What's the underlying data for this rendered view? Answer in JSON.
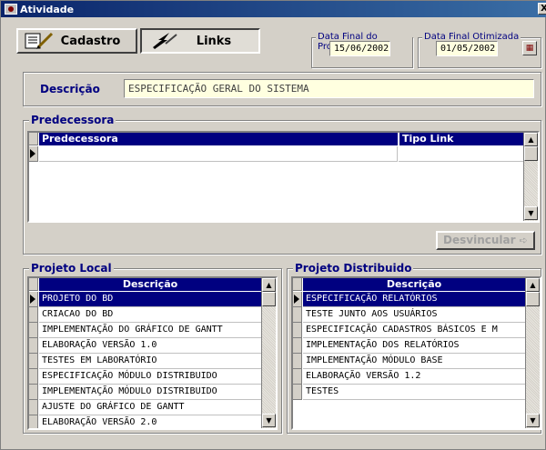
{
  "window": {
    "title": "Atividade",
    "close_glyph": "X"
  },
  "tabs": [
    {
      "label": "Cadastro",
      "icon": "notepad-pencil-icon"
    },
    {
      "label": "Links",
      "icon": "link-pen-icon"
    }
  ],
  "dates": {
    "projeto_label": "Data Final do Projeto",
    "projeto_value": "15/06/2002",
    "otimizada_label": "Data Final Otimizada",
    "otimizada_value": "01/05/2002",
    "calendar_glyph": "▦"
  },
  "descricao": {
    "label": "Descrição",
    "value": "ESPECIFICAÇÃO GERAL DO SISTEMA"
  },
  "predecessora": {
    "title": "Predecessora",
    "columns": [
      "Predecessora",
      "Tipo Link"
    ],
    "button": "Desvincular"
  },
  "projeto_local": {
    "title": "Projeto Local",
    "column": "Descrição",
    "rows": [
      "PROJETO DO BD",
      "CRIACAO DO BD",
      "IMPLEMENTAÇÃO DO GRÁFICO DE GANTT",
      "ELABORAÇÃO VERSÃO 1.0",
      "TESTES EM LABORATÓRIO",
      "ESPECIFICAÇÃO MÓDULO DISTRIBUIDO",
      "IMPLEMENTAÇÃO MÓDULO DISTRIBUIDO",
      "AJUSTE DO GRÁFICO DE GANTT",
      "ELABORAÇÃO VERSÃO 2.0"
    ]
  },
  "projeto_distribuido": {
    "title": "Projeto Distribuido",
    "column": "Descrição",
    "rows": [
      "ESPECIFICAÇÃO RELATÓRIOS",
      "TESTE JUNTO AOS USUÁRIOS",
      "ESPECIFICAÇÃO CADASTROS BÁSICOS E M",
      "IMPLEMENTAÇÃO DOS RELATÓRIOS",
      "IMPLEMENTAÇÃO MÓDULO BASE",
      "ELABORAÇÃO VERSÃO 1.2",
      "TESTES"
    ]
  },
  "colors": {
    "header": "#000080",
    "selection": "#000080",
    "field_bg": "#ffffe0",
    "face": "#d4d0c8"
  }
}
